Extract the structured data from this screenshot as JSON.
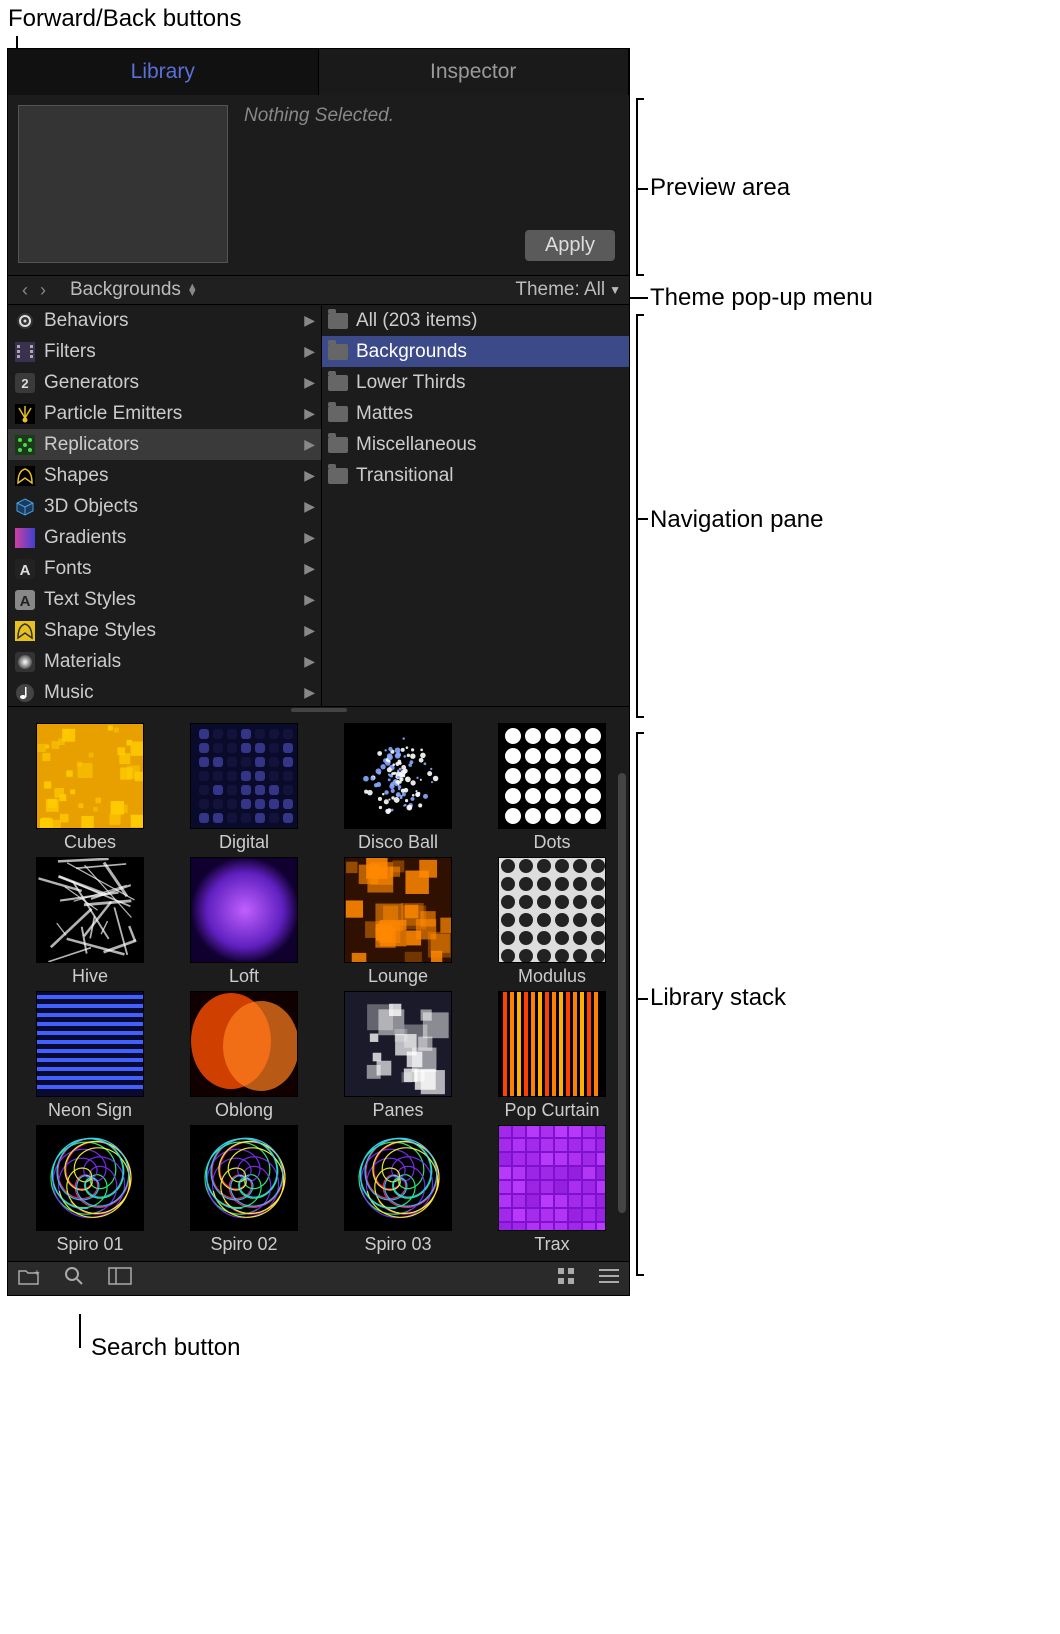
{
  "callouts": {
    "forward_back": "Forward/Back buttons",
    "preview_area": "Preview area",
    "theme_popup": "Theme pop-up menu",
    "nav_pane": "Navigation pane",
    "library_stack": "Library stack",
    "search_button": "Search button"
  },
  "tabs": {
    "library": "Library",
    "inspector": "Inspector"
  },
  "preview": {
    "status": "Nothing Selected.",
    "apply": "Apply"
  },
  "navbar": {
    "breadcrumb": "Backgrounds",
    "theme_label": "Theme: All"
  },
  "categories": [
    {
      "label": "Behaviors",
      "icon": "gear",
      "c1": "#333",
      "c2": "#ddd"
    },
    {
      "label": "Filters",
      "icon": "filmstrip",
      "c1": "#3a3050",
      "c2": "#aaa"
    },
    {
      "label": "Generators",
      "icon": "badge2",
      "c1": "#3a3a3a",
      "c2": "#ddd"
    },
    {
      "label": "Particle Emitters",
      "icon": "emitter",
      "c1": "#000",
      "c2": "#e8c020"
    },
    {
      "label": "Replicators",
      "icon": "dots",
      "c1": "#1a3a1a",
      "c2": "#4adb4a",
      "selected": true
    },
    {
      "label": "Shapes",
      "icon": "pentool",
      "c1": "#000",
      "c2": "#e8c020"
    },
    {
      "label": "3D Objects",
      "icon": "cube",
      "c1": "#1a3a60",
      "c2": "#4aa0e0"
    },
    {
      "label": "Gradients",
      "icon": "gradient",
      "c1": "#d040a0",
      "c2": "#4040d0"
    },
    {
      "label": "Fonts",
      "icon": "A",
      "c1": "#222",
      "c2": "#ddd"
    },
    {
      "label": "Text Styles",
      "icon": "A",
      "c1": "#888",
      "c2": "#222"
    },
    {
      "label": "Shape Styles",
      "icon": "pentool",
      "c1": "#e8c020",
      "c2": "#333"
    },
    {
      "label": "Materials",
      "icon": "sphere",
      "c1": "#333",
      "c2": "#bbb"
    },
    {
      "label": "Music",
      "icon": "note",
      "c1": "#444",
      "c2": "#fff"
    }
  ],
  "subcategories": [
    {
      "label": "All (203 items)"
    },
    {
      "label": "Backgrounds",
      "selected": true
    },
    {
      "label": "Lower Thirds"
    },
    {
      "label": "Mattes"
    },
    {
      "label": "Miscellaneous"
    },
    {
      "label": "Transitional"
    }
  ],
  "thumbs": [
    {
      "label": "Cubes",
      "style": "cubes"
    },
    {
      "label": "Digital",
      "style": "digital"
    },
    {
      "label": "Disco Ball",
      "style": "disco"
    },
    {
      "label": "Dots",
      "style": "dots"
    },
    {
      "label": "Hive",
      "style": "hive"
    },
    {
      "label": "Loft",
      "style": "loft"
    },
    {
      "label": "Lounge",
      "style": "lounge"
    },
    {
      "label": "Modulus",
      "style": "modulus"
    },
    {
      "label": "Neon Sign",
      "style": "neon"
    },
    {
      "label": "Oblong",
      "style": "oblong"
    },
    {
      "label": "Panes",
      "style": "panes"
    },
    {
      "label": "Pop Curtain",
      "style": "popcurtain"
    },
    {
      "label": "Spiro 01",
      "style": "spiro1"
    },
    {
      "label": "Spiro 02",
      "style": "spiro2"
    },
    {
      "label": "Spiro 03",
      "style": "spiro3"
    },
    {
      "label": "Trax",
      "style": "trax"
    }
  ]
}
